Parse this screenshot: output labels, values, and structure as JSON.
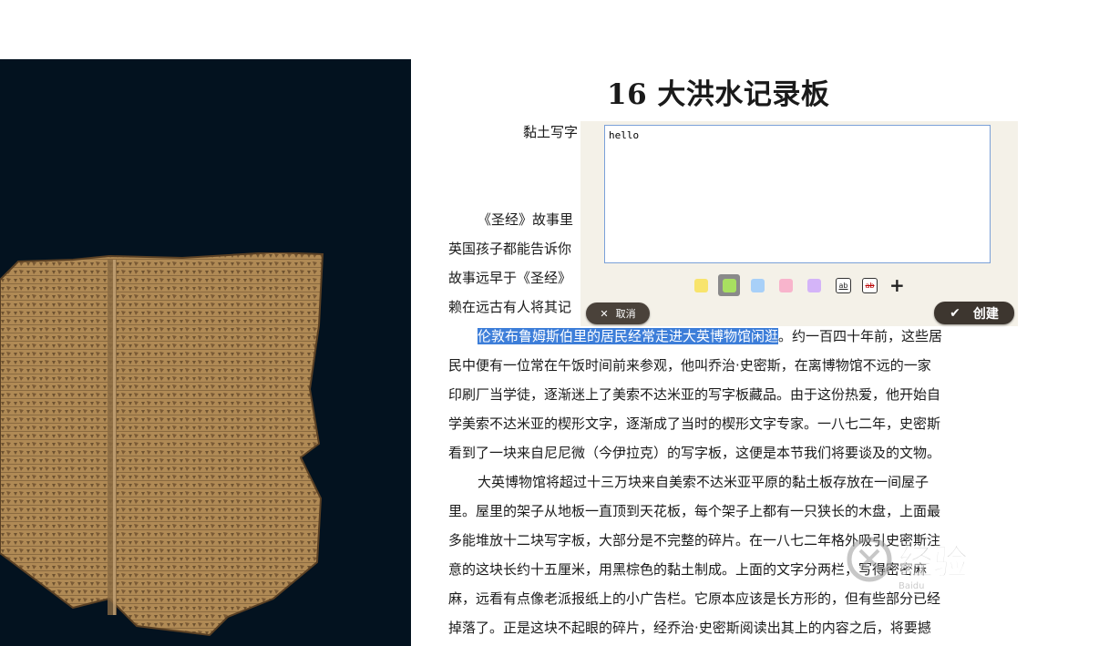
{
  "article": {
    "title": "16 大洪水记录板",
    "caption": "黏土写字",
    "para1_lines": [
      "《圣经》故事里",
      "英国孩子都能告诉你",
      "故事远早于《圣经》",
      "赖在远古有人将其记"
    ],
    "para2": {
      "highlighted": "伦敦布鲁姆斯伯里的居民经常走进大英博物馆闲逛",
      "line1_rest": "。约一百四十年前，这些居",
      "lines": [
        "民中便有一位常在午饭时间前来参观，他叫乔治·史密斯，在离博物馆不远的一家",
        "印刷厂当学徒，逐渐迷上了美索不达米亚的写字板藏品。由于这份热爱，他开始自",
        "学美索不达米亚的楔形文字，逐渐成了当时的楔形文字专家。一八七二年，史密斯",
        "看到了一块来自尼尼微（今伊拉克）的写字板，这便是本节我们将要谈及的文物。"
      ]
    },
    "para3_lines": [
      "大英博物馆将超过十三万块来自美索不达米亚平原的黏土板存放在一间屋子",
      "里。屋里的架子从地板一直顶到天花板，每个架子上都有一只狭长的木盘，上面最",
      "多能堆放十二块写字板，大部分是不完整的碎片。在一八七二年格外吸引史密斯注",
      "意的这块长约十五厘米，用黑棕色的黏土制成。上面的文字分两栏，写得密密麻",
      "麻，远看有点像老派报纸上的小广告栏。它原本应该是长方形的，但有些部分已经",
      "掉落了。正是这块不起眼的碎片，经乔治·史密斯阅读出其上的内容之后，将要撼"
    ]
  },
  "note_popup": {
    "text": "hello",
    "colors": [
      {
        "name": "yellow",
        "hex": "#f8e46c"
      },
      {
        "name": "green",
        "hex": "#a8e060"
      },
      {
        "name": "blue",
        "hex": "#a8d0f8"
      },
      {
        "name": "pink",
        "hex": "#f8b4cc"
      },
      {
        "name": "purple",
        "hex": "#d4b4f8"
      }
    ],
    "selected_color": "green",
    "underline_label": "ab",
    "strike_label": "ab",
    "cancel_label": "取消",
    "create_label": "创建"
  },
  "watermark": {
    "text": "经验",
    "brand": "Baidu"
  }
}
